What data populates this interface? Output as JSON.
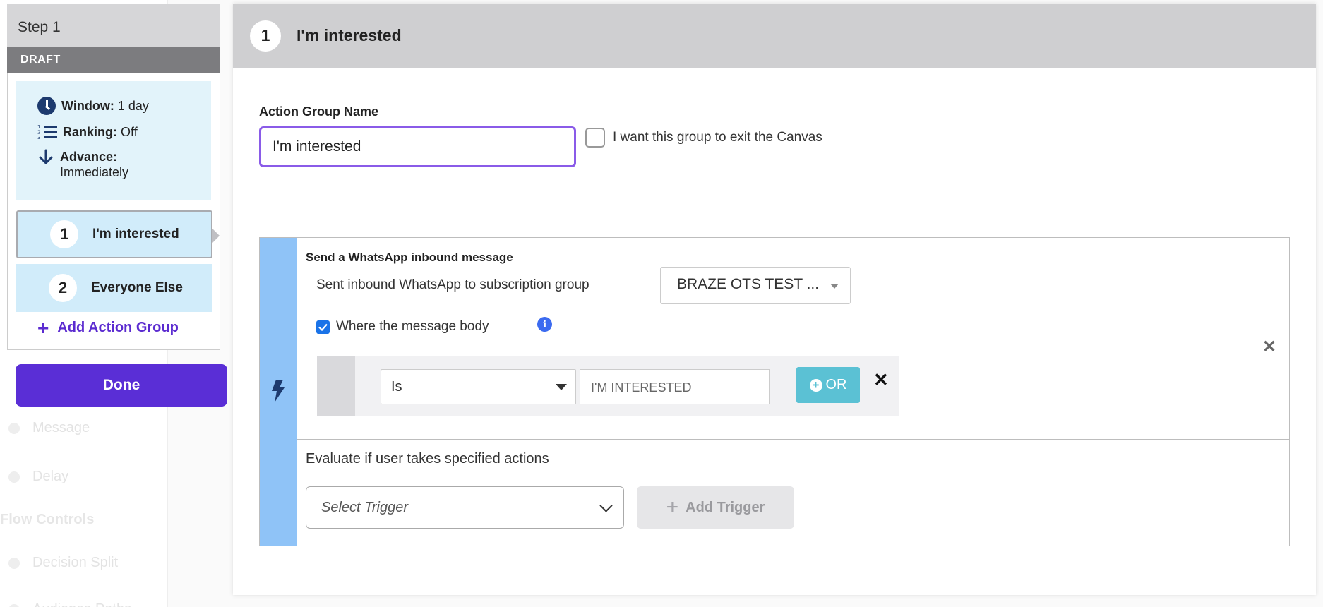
{
  "background": {
    "items": [
      {
        "label": "Message"
      },
      {
        "label": "Delay"
      }
    ],
    "section_title": "Flow Controls",
    "items2": [
      {
        "label": "Decision Split"
      },
      {
        "label": "Audience Paths"
      }
    ]
  },
  "step": {
    "title": "Step 1",
    "status": "DRAFT",
    "window_label": "Window:",
    "window_value": "1 day",
    "ranking_label": "Ranking:",
    "ranking_value": "Off",
    "advance_label": "Advance:",
    "advance_value": "Immediately",
    "action_groups": [
      {
        "num": "1",
        "label": "I'm interested"
      },
      {
        "num": "2",
        "label": "Everyone Else"
      }
    ],
    "add_group_label": "Add Action Group",
    "done_label": "Done"
  },
  "main": {
    "num": "1",
    "title": "I'm interested",
    "name_label": "Action Group Name",
    "name_value": "I'm interested",
    "exit_label": "I want this group to exit the Canvas",
    "action": {
      "title": "Send a WhatsApp inbound message",
      "subscription_label": "Sent inbound WhatsApp to subscription group",
      "subscription_value": "BRAZE OTS TEST ...",
      "body_check_label": "Where the message body",
      "operator": "Is",
      "value": "I'M INTERESTED",
      "or_label": "OR"
    },
    "eval_label": "Evaluate if user takes specified actions",
    "trigger_placeholder": "Select Trigger",
    "add_trigger_label": "Add Trigger"
  },
  "colors": {
    "accent": "#5a2ed6",
    "input_focus": "#8a5be8",
    "card_strip": "#8fc3f7",
    "or_button": "#5bc1d4",
    "group_bg": "#d1ecfa",
    "info_bg": "#e2f3fa"
  }
}
